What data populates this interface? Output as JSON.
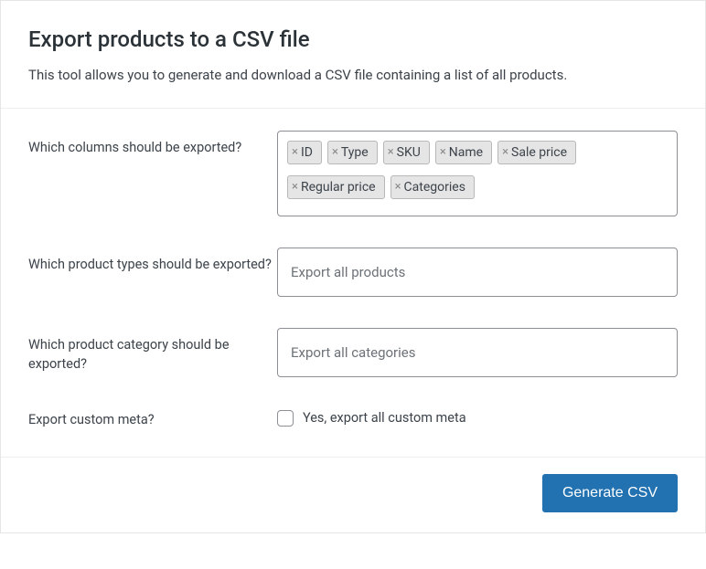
{
  "header": {
    "title": "Export products to a CSV file",
    "description": "This tool allows you to generate and download a CSV file containing a list of all products."
  },
  "form": {
    "columns": {
      "label": "Which columns should be exported?",
      "selected": [
        "ID",
        "Type",
        "SKU",
        "Name",
        "Sale price",
        "Regular price",
        "Categories"
      ]
    },
    "types": {
      "label": "Which product types should be exported?",
      "placeholder": "Export all products"
    },
    "category": {
      "label": "Which product category should be exported?",
      "placeholder": "Export all categories"
    },
    "meta": {
      "label": "Export custom meta?",
      "checkbox_label": "Yes, export all custom meta",
      "checked": false
    }
  },
  "footer": {
    "submit_label": "Generate CSV"
  }
}
